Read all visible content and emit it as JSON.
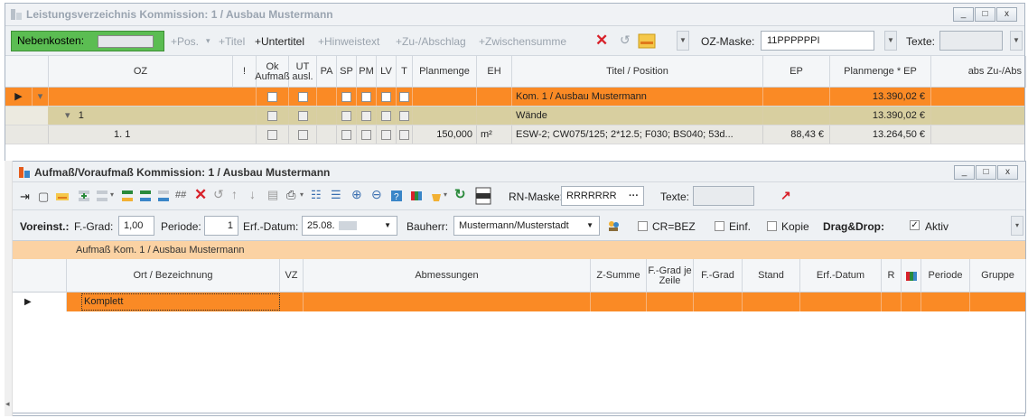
{
  "main": {
    "title": "Leistungsverzeichnis Kommission: 1 / Ausbau Mustermann",
    "window_buttons": [
      "_",
      "□",
      "x"
    ],
    "toolbar": {
      "nebenkosten": "Nebenkosten:",
      "pos": "+Pos.",
      "titel": "+Titel",
      "untertitel": "+Untertitel",
      "hinweistext": "+Hinweistext",
      "zu_abschlag": "+Zu-/Abschlag",
      "zwischensumme": "+Zwischensumme",
      "delete": "✕",
      "oz_maske_label": "OZ-Maske:",
      "oz_maske_value": "11PPPPPPI",
      "texte_label": "Texte:"
    },
    "columns": [
      "OZ",
      "!",
      "Ok Aufmaß",
      "UT ausl.",
      "PA",
      "SP",
      "PM",
      "LV",
      "T",
      "Planmenge",
      "EH",
      "Titel / Position",
      "EP",
      "Planmenge * EP",
      "abs Zu-/Abs"
    ],
    "rows": [
      {
        "oz": "",
        "title": "Kom. 1 / Ausbau Mustermann",
        "planmenge": "",
        "eh": "",
        "ep": "",
        "total": "13.390,02 €",
        "color": "#fa8a25"
      },
      {
        "oz": "1",
        "title": "Wände",
        "planmenge": "",
        "eh": "",
        "ep": "",
        "total": "13.390,02 €",
        "color": "#d8cfa0"
      },
      {
        "oz": "1.  1",
        "title": "ESW-2; CW075/125; 2*12.5; F030; BS040; 53d...",
        "planmenge": "150,000",
        "eh": "m²",
        "ep": "88,43 €",
        "total": "13.264,50 €",
        "color": "#ffffff"
      }
    ]
  },
  "inner": {
    "title": "Aufmaß/Voraufmaß Kommission: 1 / Ausbau Mustermann",
    "rn_maske_label": "RN-Maske:",
    "rn_maske_value": "RRRRRRR",
    "rn_more": "···",
    "texte_label": "Texte:",
    "voreinst": "Voreinst.:",
    "fgrad_label": "F.-Grad:",
    "fgrad_value": "1,00",
    "periode_label": "Periode:",
    "periode_value": "1",
    "erf_datum_label": "Erf.-Datum:",
    "erf_datum_value": "25.08.",
    "bauherr_label": "Bauherr:",
    "bauherr_value": "Mustermann/Musterstadt",
    "cr_bez": "CR=BEZ",
    "einf": "Einf.",
    "kopie": "Kopie",
    "drag_drop": "Drag&Drop:",
    "aktiv": "Aktiv",
    "group_label": "Aufmaß Kom. 1 / Ausbau Mustermann",
    "columns": [
      "Ort / Bezeichnung",
      "VZ",
      "Abmessungen",
      "Z-Summe",
      "F.-Grad je Zeile",
      "F.-Grad",
      "Stand",
      "Erf.-Datum",
      "R",
      "",
      "Periode",
      "Gruppe"
    ],
    "row_value": "Komplett"
  }
}
